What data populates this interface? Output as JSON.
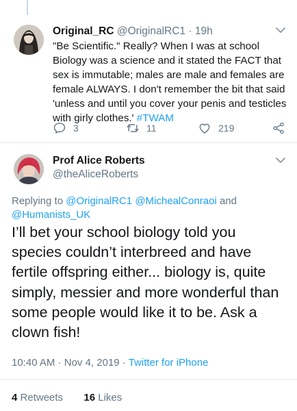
{
  "tweet_parent": {
    "author_name": "Original_RC",
    "author_handle": "@OriginalRC1",
    "separator": "·",
    "time_ago": "19h",
    "text_main": "\"Be Scientific.\" Really?  When I was at school Biology was a science and it stated the FACT that sex is immutable; males are male and females are female ALWAYS. I don't remember the bit that said 'unless and until you cover your penis and testicles with girly clothes.'",
    "hashtag": "#TWAM",
    "reply_count": "3",
    "retweet_count": "11",
    "like_count": "219"
  },
  "tweet_main": {
    "author_name": "Prof Alice Roberts",
    "author_handle": "@theAliceRoberts",
    "replying_prefix": "Replying to",
    "mention_1": "@OriginalRC1",
    "mention_2": "@MichealConraoi",
    "and_word": "and",
    "mention_3": "@Humanists_UK",
    "text": "I’ll bet your school biology told you species couldn’t interbreed and have fertile offspring either... biology is, quite simply, messier and more wonderful than some people would like it to be. Ask a clown fish!",
    "time": "10:40 AM",
    "date": "Nov 4, 2019",
    "source": "Twitter for iPhone",
    "meta_sep": "·",
    "retweets_count": "4",
    "retweets_label": "Retweets",
    "likes_count": "16",
    "likes_label": "Likes"
  },
  "colors": {
    "link": "#1da1f2",
    "secondary": "#657786",
    "text": "#14171a",
    "divider": "#e1e8ed"
  },
  "icons": [
    "reply-icon",
    "retweet-icon",
    "like-icon",
    "share-icon",
    "chevron-down-icon"
  ]
}
